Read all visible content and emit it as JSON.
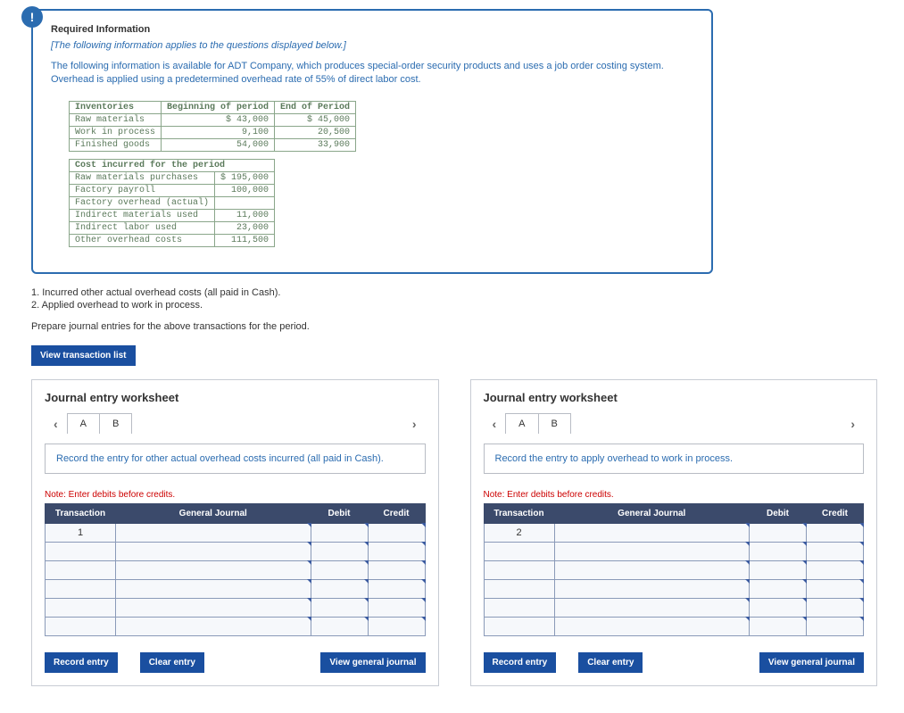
{
  "req": {
    "title": "Required Information",
    "subtitle": "[The following information applies to the questions displayed below.]",
    "paragraph": "The following information is available for ADT Company, which produces special-order security products and uses a job order costing system. Overhead is applied using a predetermined overhead rate of 55% of direct labor cost."
  },
  "inv_table": {
    "headers": [
      "Inventories",
      "Beginning of period",
      "End of Period"
    ],
    "rows": [
      [
        "Raw materials",
        "$ 43,000",
        "$ 45,000"
      ],
      [
        "Work in process",
        "9,100",
        "20,500"
      ],
      [
        "Finished goods",
        "54,000",
        "33,900"
      ]
    ]
  },
  "cost_table": {
    "header": "Cost incurred for the period",
    "rows": [
      [
        "Raw materials purchases",
        "$ 195,000"
      ],
      [
        "Factory payroll",
        "100,000"
      ],
      [
        "Factory overhead (actual)",
        ""
      ],
      [
        "Indirect materials used",
        "11,000"
      ],
      [
        "Indirect labor used",
        "23,000"
      ],
      [
        "Other overhead costs",
        "111,500"
      ]
    ]
  },
  "steps": {
    "s1": "1. Incurred other actual overhead costs (all paid in Cash).",
    "s2": "2. Applied overhead to work in process."
  },
  "prepare": "Prepare journal entries for the above transactions for the period.",
  "view_list": "View transaction list",
  "worksheet_title": "Journal entry worksheet",
  "tabs": {
    "a": "A",
    "b": "B"
  },
  "instr": {
    "left": "Record the entry for other actual overhead costs incurred (all paid in Cash).",
    "right": "Record the entry to apply overhead to work in process."
  },
  "note": "Note: Enter debits before credits.",
  "grid_headers": {
    "tx": "Transaction",
    "gj": "General Journal",
    "debit": "Debit",
    "credit": "Credit"
  },
  "tx_values": {
    "left": "1",
    "right": "2"
  },
  "btns": {
    "record": "Record entry",
    "clear": "Clear entry",
    "view_gj": "View general journal"
  }
}
